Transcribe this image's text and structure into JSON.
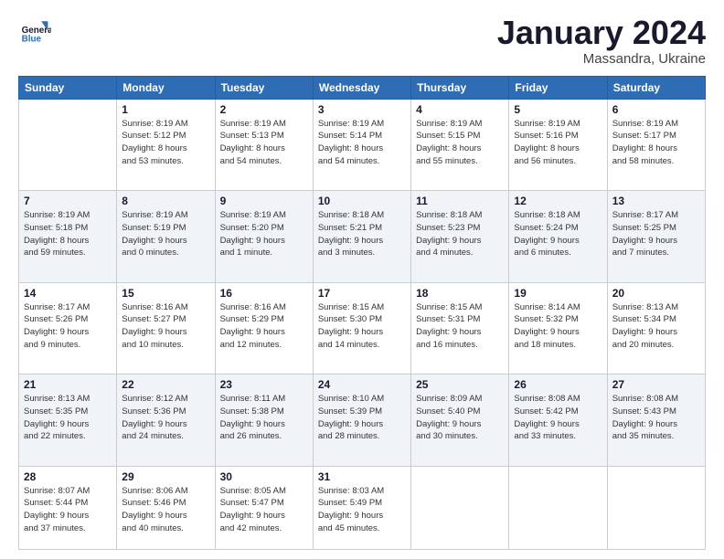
{
  "logo": {
    "line1": "General",
    "line2": "Blue"
  },
  "header": {
    "month": "January 2024",
    "location": "Massandra, Ukraine"
  },
  "weekdays": [
    "Sunday",
    "Monday",
    "Tuesday",
    "Wednesday",
    "Thursday",
    "Friday",
    "Saturday"
  ],
  "weeks": [
    [
      {
        "day": null,
        "info": null
      },
      {
        "day": "1",
        "info": "Sunrise: 8:19 AM\nSunset: 5:12 PM\nDaylight: 8 hours\nand 53 minutes."
      },
      {
        "day": "2",
        "info": "Sunrise: 8:19 AM\nSunset: 5:13 PM\nDaylight: 8 hours\nand 54 minutes."
      },
      {
        "day": "3",
        "info": "Sunrise: 8:19 AM\nSunset: 5:14 PM\nDaylight: 8 hours\nand 54 minutes."
      },
      {
        "day": "4",
        "info": "Sunrise: 8:19 AM\nSunset: 5:15 PM\nDaylight: 8 hours\nand 55 minutes."
      },
      {
        "day": "5",
        "info": "Sunrise: 8:19 AM\nSunset: 5:16 PM\nDaylight: 8 hours\nand 56 minutes."
      },
      {
        "day": "6",
        "info": "Sunrise: 8:19 AM\nSunset: 5:17 PM\nDaylight: 8 hours\nand 58 minutes."
      }
    ],
    [
      {
        "day": "7",
        "info": "Sunrise: 8:19 AM\nSunset: 5:18 PM\nDaylight: 8 hours\nand 59 minutes."
      },
      {
        "day": "8",
        "info": "Sunrise: 8:19 AM\nSunset: 5:19 PM\nDaylight: 9 hours\nand 0 minutes."
      },
      {
        "day": "9",
        "info": "Sunrise: 8:19 AM\nSunset: 5:20 PM\nDaylight: 9 hours\nand 1 minute."
      },
      {
        "day": "10",
        "info": "Sunrise: 8:18 AM\nSunset: 5:21 PM\nDaylight: 9 hours\nand 3 minutes."
      },
      {
        "day": "11",
        "info": "Sunrise: 8:18 AM\nSunset: 5:23 PM\nDaylight: 9 hours\nand 4 minutes."
      },
      {
        "day": "12",
        "info": "Sunrise: 8:18 AM\nSunset: 5:24 PM\nDaylight: 9 hours\nand 6 minutes."
      },
      {
        "day": "13",
        "info": "Sunrise: 8:17 AM\nSunset: 5:25 PM\nDaylight: 9 hours\nand 7 minutes."
      }
    ],
    [
      {
        "day": "14",
        "info": "Sunrise: 8:17 AM\nSunset: 5:26 PM\nDaylight: 9 hours\nand 9 minutes."
      },
      {
        "day": "15",
        "info": "Sunrise: 8:16 AM\nSunset: 5:27 PM\nDaylight: 9 hours\nand 10 minutes."
      },
      {
        "day": "16",
        "info": "Sunrise: 8:16 AM\nSunset: 5:29 PM\nDaylight: 9 hours\nand 12 minutes."
      },
      {
        "day": "17",
        "info": "Sunrise: 8:15 AM\nSunset: 5:30 PM\nDaylight: 9 hours\nand 14 minutes."
      },
      {
        "day": "18",
        "info": "Sunrise: 8:15 AM\nSunset: 5:31 PM\nDaylight: 9 hours\nand 16 minutes."
      },
      {
        "day": "19",
        "info": "Sunrise: 8:14 AM\nSunset: 5:32 PM\nDaylight: 9 hours\nand 18 minutes."
      },
      {
        "day": "20",
        "info": "Sunrise: 8:13 AM\nSunset: 5:34 PM\nDaylight: 9 hours\nand 20 minutes."
      }
    ],
    [
      {
        "day": "21",
        "info": "Sunrise: 8:13 AM\nSunset: 5:35 PM\nDaylight: 9 hours\nand 22 minutes."
      },
      {
        "day": "22",
        "info": "Sunrise: 8:12 AM\nSunset: 5:36 PM\nDaylight: 9 hours\nand 24 minutes."
      },
      {
        "day": "23",
        "info": "Sunrise: 8:11 AM\nSunset: 5:38 PM\nDaylight: 9 hours\nand 26 minutes."
      },
      {
        "day": "24",
        "info": "Sunrise: 8:10 AM\nSunset: 5:39 PM\nDaylight: 9 hours\nand 28 minutes."
      },
      {
        "day": "25",
        "info": "Sunrise: 8:09 AM\nSunset: 5:40 PM\nDaylight: 9 hours\nand 30 minutes."
      },
      {
        "day": "26",
        "info": "Sunrise: 8:08 AM\nSunset: 5:42 PM\nDaylight: 9 hours\nand 33 minutes."
      },
      {
        "day": "27",
        "info": "Sunrise: 8:08 AM\nSunset: 5:43 PM\nDaylight: 9 hours\nand 35 minutes."
      }
    ],
    [
      {
        "day": "28",
        "info": "Sunrise: 8:07 AM\nSunset: 5:44 PM\nDaylight: 9 hours\nand 37 minutes."
      },
      {
        "day": "29",
        "info": "Sunrise: 8:06 AM\nSunset: 5:46 PM\nDaylight: 9 hours\nand 40 minutes."
      },
      {
        "day": "30",
        "info": "Sunrise: 8:05 AM\nSunset: 5:47 PM\nDaylight: 9 hours\nand 42 minutes."
      },
      {
        "day": "31",
        "info": "Sunrise: 8:03 AM\nSunset: 5:49 PM\nDaylight: 9 hours\nand 45 minutes."
      },
      {
        "day": null,
        "info": null
      },
      {
        "day": null,
        "info": null
      },
      {
        "day": null,
        "info": null
      }
    ]
  ]
}
